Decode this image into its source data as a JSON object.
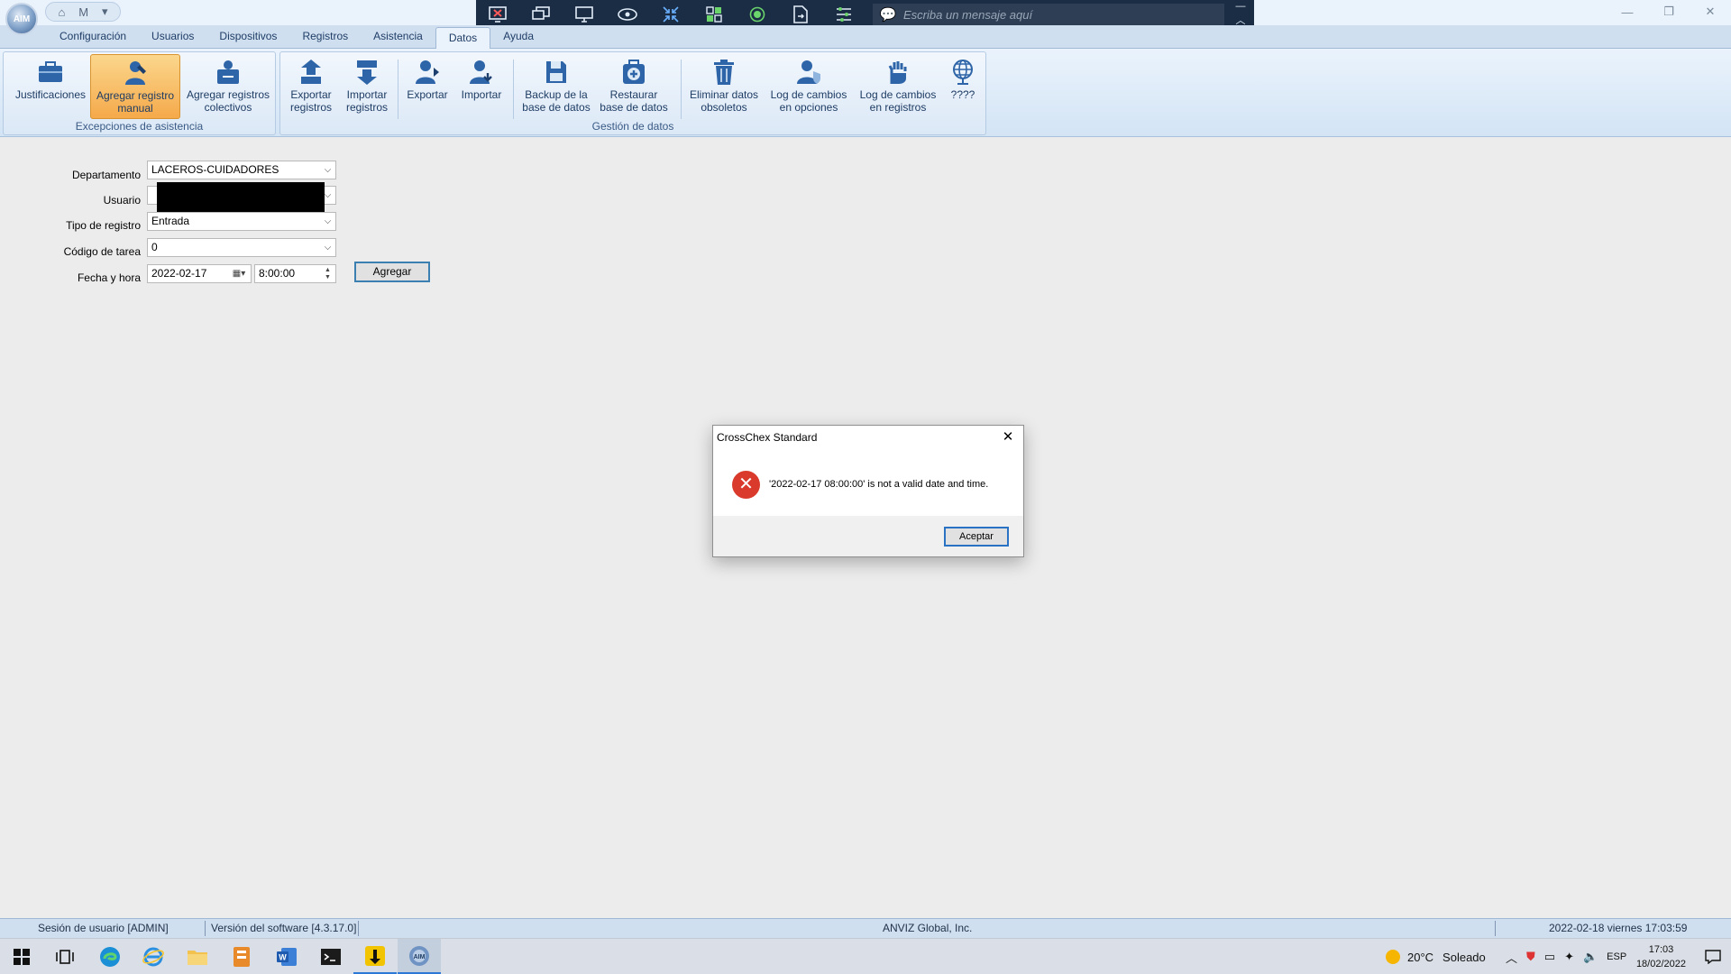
{
  "app": {
    "logo_text": "AIM"
  },
  "remote_toolbar": {
    "message_placeholder": "Escriba un mensaje aquí"
  },
  "tabs": [
    "Configuración",
    "Usuarios",
    "Dispositivos",
    "Registros",
    "Asistencia",
    "Datos",
    "Ayuda"
  ],
  "active_tab": "Datos",
  "ribbon": {
    "groups": [
      {
        "label": "Excepciones de asistencia"
      },
      {
        "label": "Gestión de datos"
      }
    ],
    "buttons": [
      {
        "label": "Justificaciones",
        "icon": "briefcase-icon"
      },
      {
        "label": "Agregar registro manual",
        "icon": "user-pen-icon",
        "selected": true
      },
      {
        "label": "Agregar registros colectivos",
        "icon": "users-pen-icon"
      },
      {
        "label": "Exportar registros",
        "icon": "export-records-icon"
      },
      {
        "label": "Importar registros",
        "icon": "import-records-icon"
      },
      {
        "label": "Exportar",
        "icon": "user-export-icon"
      },
      {
        "label": "Importar",
        "icon": "user-import-icon"
      },
      {
        "label": "Backup de la base de datos",
        "icon": "floppy-disk-icon"
      },
      {
        "label": "Restaurar base de datos",
        "icon": "restore-db-icon"
      },
      {
        "label": "Eliminar datos obsoletos",
        "icon": "trash-icon"
      },
      {
        "label": "Log de cambios en opciones",
        "icon": "user-shield-icon"
      },
      {
        "label": "Log de cambios en registros",
        "icon": "hand-log-icon"
      },
      {
        "label": "????",
        "icon": "globe-icon"
      }
    ]
  },
  "form": {
    "departamento": {
      "label": "Departamento",
      "value": "LACEROS-CUIDADORES"
    },
    "usuario": {
      "label": "Usuario",
      "value": ""
    },
    "tipo_registro": {
      "label": "Tipo de registro",
      "value": "Entrada"
    },
    "codigo_tarea": {
      "label": "Código de tarea",
      "value": "0"
    },
    "fecha_hora": {
      "label": "Fecha y hora",
      "date": "2022-02-17",
      "time": "8:00:00"
    },
    "add_button": "Agregar"
  },
  "dialog": {
    "title": "CrossChex Standard",
    "message": "'2022-02-17 08:00:00' is not a valid date and time.",
    "ok_button": "Aceptar",
    "icon": "error-icon"
  },
  "statusbar": {
    "session": "Sesión de usuario  [ADMIN]",
    "version": "Versión del software  [4.3.17.0]",
    "company": "ANVIZ Global, Inc.",
    "datetime": "2022-02-18 viernes 17:03:59"
  },
  "taskbar": {
    "weather_temp": "20°C",
    "weather_text": "Soleado",
    "language": "ESP",
    "clock_time": "17:03",
    "clock_date": "18/02/2022"
  }
}
